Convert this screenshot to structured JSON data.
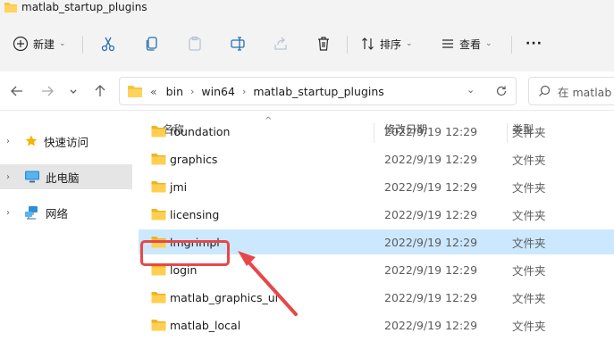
{
  "window": {
    "title": "matlab_startup_plugins"
  },
  "toolbar": {
    "new_label": "新建",
    "sort_label": "排序",
    "view_label": "查看",
    "more_label": "···"
  },
  "address": {
    "overflow": "«",
    "crumbs": [
      "bin",
      "win64",
      "matlab_startup_plugins"
    ]
  },
  "search": {
    "placeholder": "在 matlab"
  },
  "sidebar": {
    "items": [
      {
        "label": "快速访问",
        "icon": "star-icon"
      },
      {
        "label": "此电脑",
        "icon": "computer-icon",
        "selected": true
      },
      {
        "label": "网络",
        "icon": "network-icon"
      }
    ]
  },
  "columns": {
    "name": "名称",
    "date": "修改日期",
    "type": "类型"
  },
  "files": [
    {
      "name": "foundation",
      "date": "2022/9/19 12:29",
      "type": "文件夹"
    },
    {
      "name": "graphics",
      "date": "2022/9/19 12:29",
      "type": "文件夹"
    },
    {
      "name": "jmi",
      "date": "2022/9/19 12:29",
      "type": "文件夹"
    },
    {
      "name": "licensing",
      "date": "2022/9/19 12:29",
      "type": "文件夹"
    },
    {
      "name": "lmgrimpl",
      "date": "2022/9/19 12:29",
      "type": "文件夹",
      "selected": true
    },
    {
      "name": "login",
      "date": "2022/9/19 12:29",
      "type": "文件夹"
    },
    {
      "name": "matlab_graphics_ui",
      "date": "2022/9/19 12:29",
      "type": "文件夹"
    },
    {
      "name": "matlab_local",
      "date": "2022/9/19 12:29",
      "type": "文件夹"
    }
  ],
  "colors": {
    "selection": "#cce8ff",
    "annotation": "#e8474a",
    "folder": "#f8c542"
  }
}
